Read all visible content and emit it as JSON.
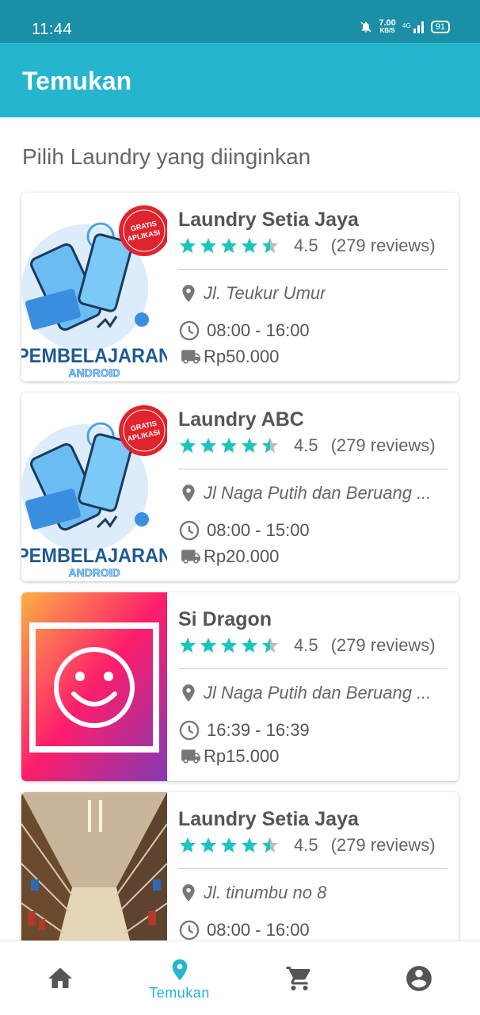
{
  "status": {
    "time": "11:44",
    "net_speed": "7.00",
    "net_unit": "KB/S",
    "battery": "91"
  },
  "appbar": {
    "title": "Temukan"
  },
  "subtitle": "Pilih Laundry yang diinginkan",
  "laundries": [
    {
      "name": "Laundry Setia Jaya",
      "rating": "4.5",
      "stars_value": 4.5,
      "reviews": "(279 reviews)",
      "address": "Jl. Teukur Umur",
      "hours": "08:00 - 16:00",
      "price": "Rp50.000",
      "image": "promo-android",
      "promo_badge": "GRATIS APLIKASI",
      "promo_title": "PEMBELAJARAN",
      "promo_subtitle": "ANDROID"
    },
    {
      "name": "Laundry ABC",
      "rating": "4.5",
      "stars_value": 4.5,
      "reviews": "(279 reviews)",
      "address": "Jl Naga Putih dan Beruang ...",
      "hours": "08:00 - 15:00",
      "price": "Rp20.000",
      "image": "promo-android",
      "promo_badge": "GRATIS APLIKASI",
      "promo_title": "PEMBELAJARAN",
      "promo_subtitle": "ANDROID"
    },
    {
      "name": "Si Dragon",
      "rating": "4.5",
      "stars_value": 4.5,
      "reviews": "(279 reviews)",
      "address": "Jl Naga Putih dan Beruang ...",
      "hours": "16:39 - 16:39",
      "price": "Rp15.000",
      "image": "smiley-gradient"
    },
    {
      "name": "Laundry Setia Jaya",
      "rating": "4.5",
      "stars_value": 4.5,
      "reviews": "(279 reviews)",
      "address": "Jl. tinumbu no 8",
      "hours": "08:00 - 16:00",
      "price": "",
      "image": "store-aisle"
    }
  ],
  "bottom_nav": [
    {
      "icon": "home-icon",
      "label": "",
      "active": false
    },
    {
      "icon": "location-pin-icon",
      "label": "Temukan",
      "active": true
    },
    {
      "icon": "cart-icon",
      "label": "",
      "active": false
    },
    {
      "icon": "account-icon",
      "label": "",
      "active": false
    }
  ],
  "colors": {
    "primary": "#26b5cf",
    "status_bar": "#1a8fa6",
    "star": "#1bc5bd",
    "text_grey": "#666666"
  }
}
